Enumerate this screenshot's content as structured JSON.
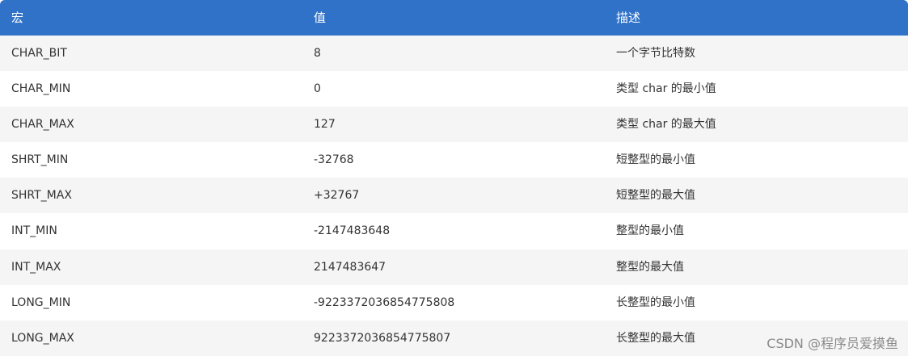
{
  "table": {
    "headers": [
      "宏",
      "值",
      "描述"
    ],
    "rows": [
      [
        "CHAR_BIT",
        "8",
        "一个字节比特数"
      ],
      [
        "CHAR_MIN",
        "0",
        "类型 char 的最小值"
      ],
      [
        "CHAR_MAX",
        "127",
        "类型 char 的最大值"
      ],
      [
        "SHRT_MIN",
        "-32768",
        "短整型的最小值"
      ],
      [
        "SHRT_MAX",
        "+32767",
        "短整型的最大值"
      ],
      [
        "INT_MIN",
        "-2147483648",
        "整型的最小值"
      ],
      [
        "INT_MAX",
        "2147483647",
        "整型的最大值"
      ],
      [
        "LONG_MIN",
        "-9223372036854775808",
        "长整型的最小值"
      ],
      [
        "LONG_MAX",
        "9223372036854775807",
        "长整型的最大值"
      ]
    ]
  },
  "watermark": "CSDN @程序员爱摸鱼",
  "colors": {
    "header_bg": "#3072c8",
    "header_text": "#ffffff",
    "row_alt_bg": "#f5f5f5",
    "text": "#333333"
  }
}
